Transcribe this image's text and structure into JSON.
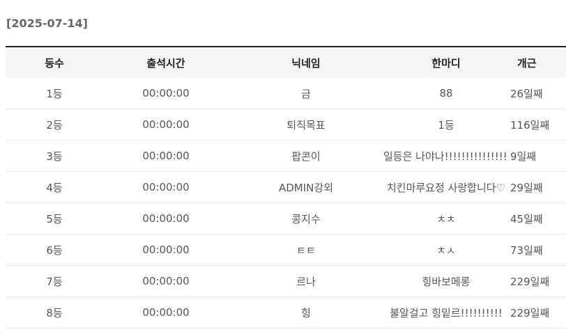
{
  "date_label": "[2025-07-14]",
  "table": {
    "headers": {
      "rank": "등수",
      "time": "출석시간",
      "nickname": "닉네임",
      "comment": "한마디",
      "days": "개근"
    },
    "rows": [
      {
        "rank": "1등",
        "time": "00:00:00",
        "nickname": "금",
        "comment": "88",
        "days": "26일째"
      },
      {
        "rank": "2등",
        "time": "00:00:00",
        "nickname": "퇴직목표",
        "comment": "1등",
        "days": "116일째"
      },
      {
        "rank": "3등",
        "time": "00:00:00",
        "nickname": "팝콘이",
        "comment": "일등은 나야나!!!!!!!!!!!!!!! …",
        "days": "9일째"
      },
      {
        "rank": "4등",
        "time": "00:00:00",
        "nickname": "ADMIN강외",
        "comment": "치킨마루요정 사랑합니다♡",
        "days": "29일째"
      },
      {
        "rank": "5등",
        "time": "00:00:00",
        "nickname": "콩지수",
        "comment": "ㅊㅊ",
        "days": "45일째"
      },
      {
        "rank": "6등",
        "time": "00:00:00",
        "nickname": "ㅌㅌ",
        "comment": "ㅊㅅ",
        "days": "73일째"
      },
      {
        "rank": "7등",
        "time": "00:00:00",
        "nickname": "르나",
        "comment": "힝바보메롱",
        "days": "229일째"
      },
      {
        "rank": "8등",
        "time": "00:00:00",
        "nickname": "힝",
        "comment": "불알걸고 힝밑르!!!!!!!!!!",
        "days": "229일째"
      }
    ]
  }
}
